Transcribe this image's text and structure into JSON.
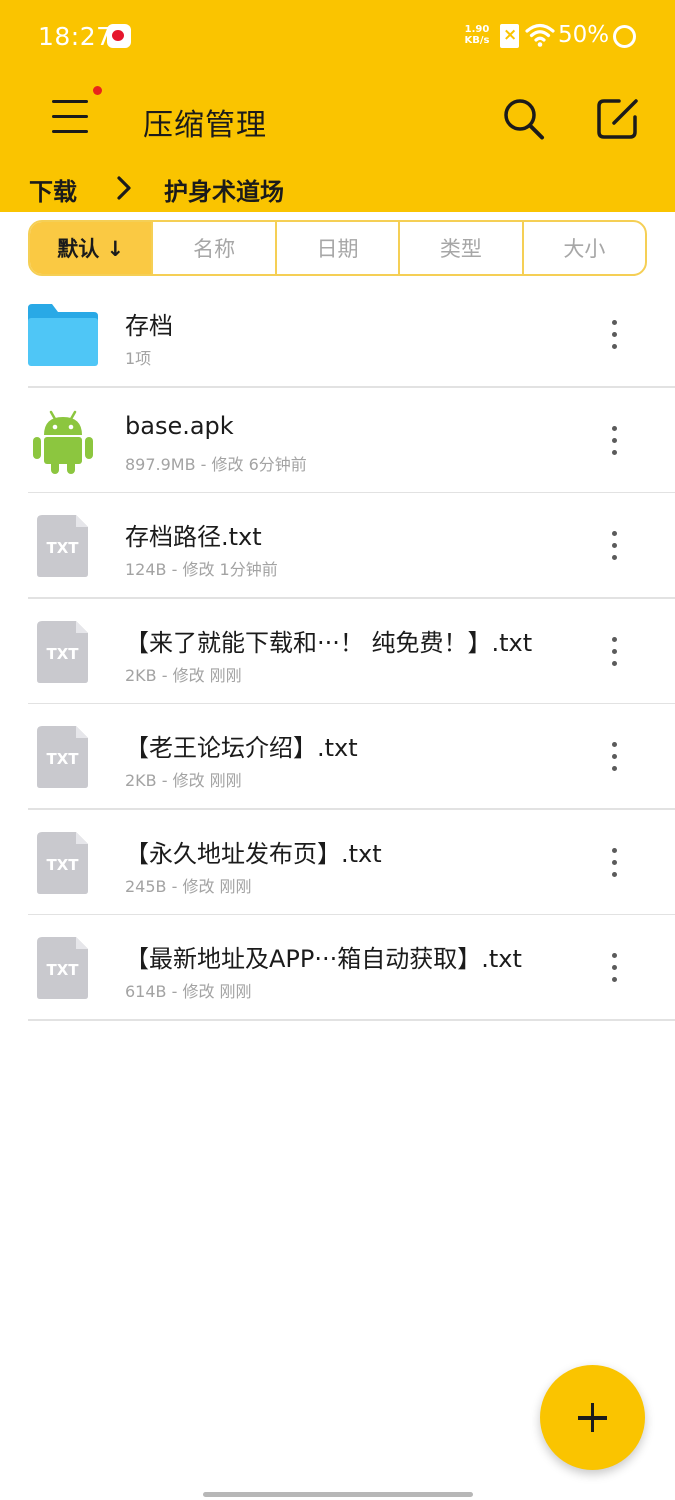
{
  "status_bar": {
    "time": "18:27",
    "net_speed_value": "1.90",
    "net_speed_unit": "KB/s",
    "battery": "50%"
  },
  "header": {
    "title": "压缩管理",
    "menu_icon": "hamburger-menu-icon",
    "notification_dot_color": "#e8241b",
    "search_icon": "search-icon",
    "edit_icon": "edit-icon",
    "accent_color": "#fac400"
  },
  "breadcrumb": {
    "parent": "下载",
    "current": "护身术道场"
  },
  "sort_tabs": [
    {
      "label": "默认 ↓",
      "active": true
    },
    {
      "label": "名称",
      "active": false
    },
    {
      "label": "日期",
      "active": false
    },
    {
      "label": "类型",
      "active": false
    },
    {
      "label": "大小",
      "active": false
    }
  ],
  "files": [
    {
      "name": "存档",
      "meta": "1项",
      "icon": "folder-icon"
    },
    {
      "name": "base.apk",
      "meta": "897.9MB - 修改 6分钟前",
      "icon": "android-icon"
    },
    {
      "name": "存档路径.txt",
      "meta": "124B - 修改 1分钟前",
      "icon": "txt-file-icon"
    },
    {
      "name": "【来了就能下载和···！ 纯免费！】.txt",
      "meta": "2KB - 修改 刚刚",
      "icon": "txt-file-icon"
    },
    {
      "name": "【老王论坛介绍】.txt",
      "meta": "2KB - 修改 刚刚",
      "icon": "txt-file-icon"
    },
    {
      "name": "【永久地址发布页】.txt",
      "meta": "245B - 修改 刚刚",
      "icon": "txt-file-icon"
    },
    {
      "name": "【最新地址及APP···箱自动获取】.txt",
      "meta": "614B - 修改 刚刚",
      "icon": "txt-file-icon"
    }
  ],
  "file_icon_label": "TXT",
  "fab_icon": "plus-icon"
}
